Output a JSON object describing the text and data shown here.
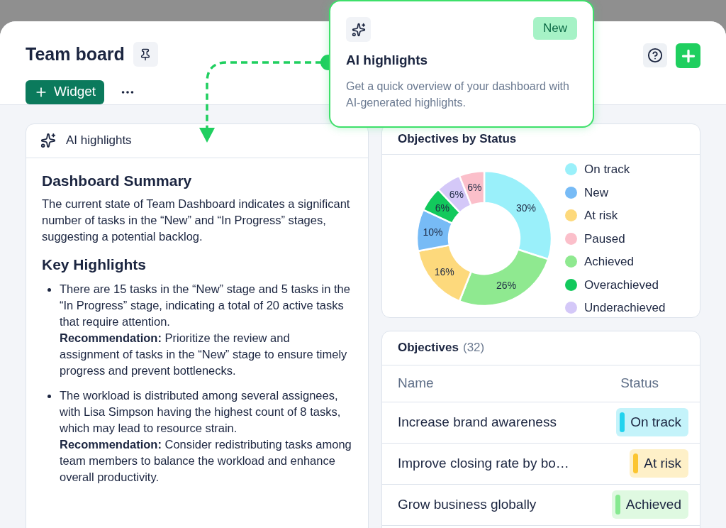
{
  "header": {
    "title": "Team board",
    "widget_button": "Widget"
  },
  "popover": {
    "badge": "New",
    "title": "AI highlights",
    "description": "Get a quick overview of your dashboard with AI-generated highlights."
  },
  "ai_card": {
    "title": "AI highlights",
    "summary_heading": "Dashboard Summary",
    "summary": "The current state of Team Dashboard indicates a significant number of tasks in the “New” and “In Progress” stages, suggesting a potential backlog.",
    "highlights_heading": "Key Highlights",
    "highlights": [
      {
        "text": "There are 15 tasks in the “New” stage and 5 tasks in the “In Progress” stage, indicating a total of 20 active tasks that require attention.",
        "recommendation": "**Recommendation:** Prioritize the review and assignment of tasks in the “New” stage to ensure timely progress and prevent bottlenecks."
      },
      {
        "text": "The workload is distributed among several assignees, with Lisa Simpson having the highest count of 8 tasks, which may lead to resource strain.",
        "recommendation": "**Recommendation:** Consider redistributing tasks among team members to balance the workload and enhance overall productivity."
      }
    ]
  },
  "status_card": {
    "title": "Objectives by Status",
    "chart_data": {
      "type": "donut",
      "categories": [
        "On track",
        "Achieved",
        "At risk",
        "New",
        "Overachieved",
        "Underachieved",
        "Paused"
      ],
      "values": [
        30,
        26,
        16,
        10,
        6,
        6,
        6
      ],
      "colors": [
        "#9af0fa",
        "#8fe990",
        "#fdd97c",
        "#77bbf6",
        "#12c95c",
        "#d4c8f8",
        "#fbbfca"
      ],
      "value_labels": [
        "30%",
        "26%",
        "16%",
        "10%",
        "6%",
        "6%",
        "6%"
      ]
    }
  },
  "objectives": {
    "title": "Objectives",
    "count": "(32)",
    "columns": [
      "Name",
      "Status"
    ],
    "rows": [
      {
        "name": "Increase brand awareness",
        "status": "On track",
        "color": "#22d3ee"
      },
      {
        "name": "Improve closing rate by bo…",
        "status": "At risk",
        "color": "#fbc531"
      },
      {
        "name": "Grow business globally",
        "status": "Achieved",
        "color": "#86e990"
      }
    ]
  }
}
